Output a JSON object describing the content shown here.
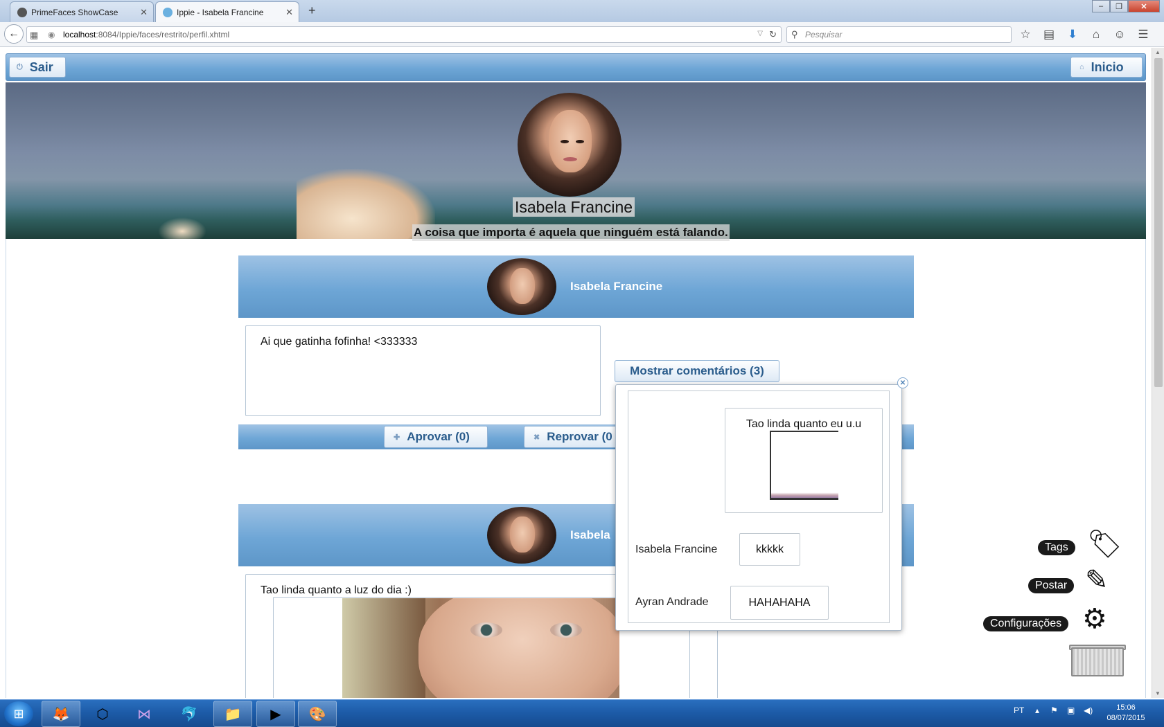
{
  "browser": {
    "tabs": [
      {
        "title": "PrimeFaces ShowCase"
      },
      {
        "title": "Ippie - Isabela Francine"
      }
    ],
    "url_host": "localhost",
    "url_path": ":8084/Ippie/faces/restrito/perfil.xhtml",
    "search_placeholder": "Pesquisar"
  },
  "topbar": {
    "logout_label": "Sair",
    "home_label": "Inicio"
  },
  "profile": {
    "name": "Isabela Francine",
    "quote": "A coisa que importa é aquela que ninguém está falando."
  },
  "posts": [
    {
      "author": "Isabela Francine",
      "text": "Ai que gatinha fofinha! <333333",
      "show_comments_label": "Mostrar comentários (3)",
      "approve_label": "Aprovar (0)",
      "reject_label": "Reprovar (0"
    },
    {
      "author": "Isabela",
      "text": "Tao linda quanto a luz do dia :)"
    }
  ],
  "comments": [
    {
      "author": "",
      "text": "Tao linda quanto eu u.u"
    },
    {
      "author": "Isabela Francine",
      "text": "kkkkk"
    },
    {
      "author": "Ayran Andrade",
      "text": "HAHAHAHA"
    }
  ],
  "floating_menu": {
    "tags_label": "Tags",
    "post_label": "Postar",
    "settings_label": "Configurações"
  },
  "taskbar": {
    "language": "PT",
    "time": "15:06",
    "date": "08/07/2015"
  },
  "colors": {
    "header_blue": "#6ea6d6",
    "button_text": "#2a5c8c"
  }
}
